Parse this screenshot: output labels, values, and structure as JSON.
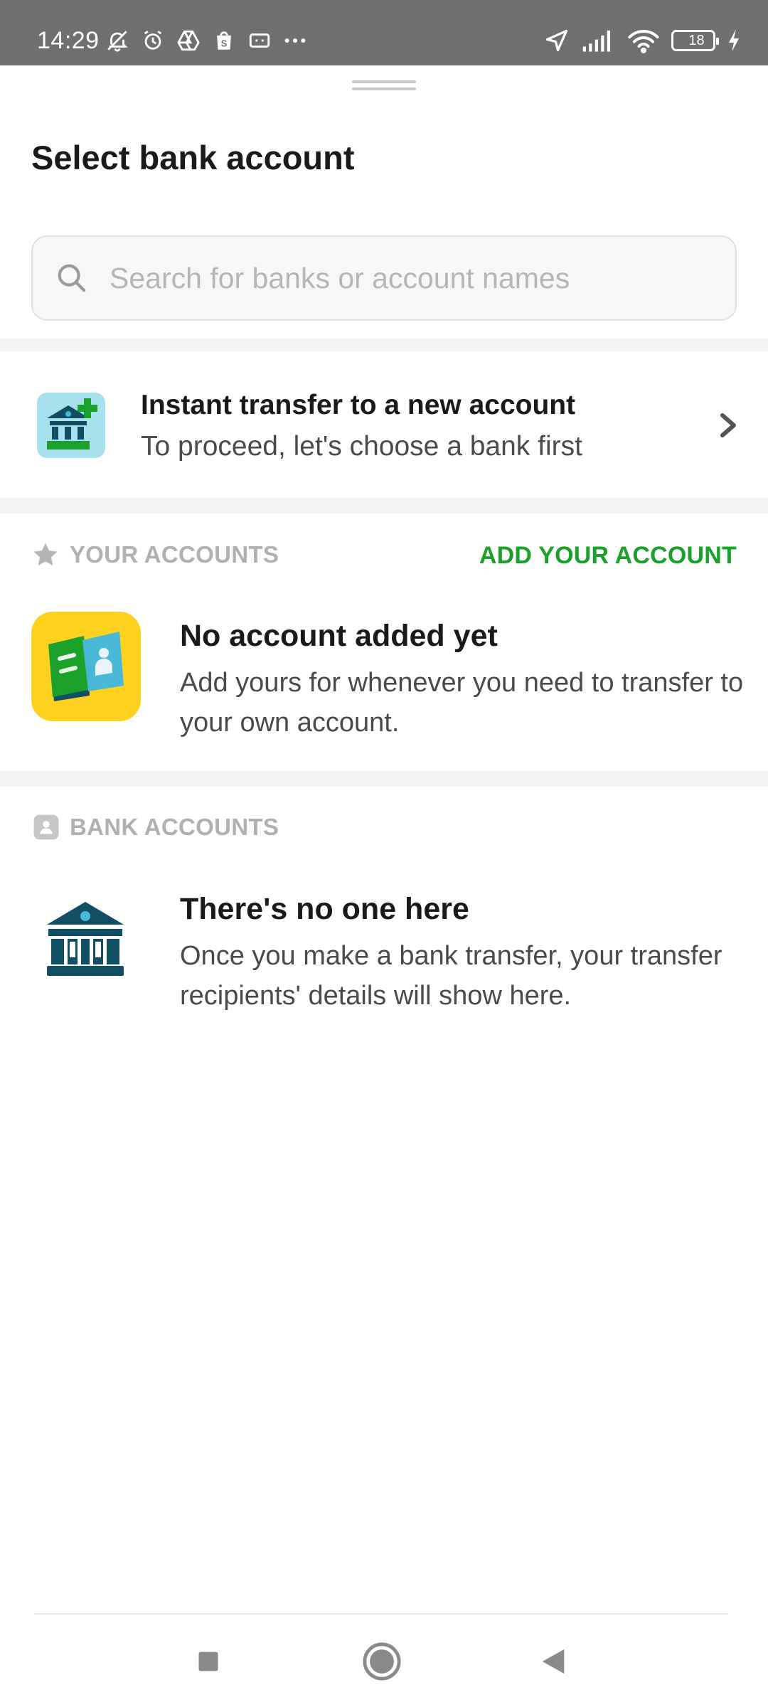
{
  "status_bar": {
    "time": "14:29",
    "battery_level": "18",
    "left_icons": [
      "mute-bell-icon",
      "alarm-icon",
      "drive-icon",
      "shop-icon",
      "card-icon",
      "more-dots-icon"
    ],
    "right_icons": [
      "location-arrow-icon",
      "signal-icon",
      "wifi-icon",
      "battery-icon",
      "charging-icon"
    ]
  },
  "sheet": {
    "title": "Select bank account"
  },
  "search": {
    "placeholder": "Search for banks or account names",
    "value": ""
  },
  "instant_transfer": {
    "title": "Instant transfer to a new account",
    "subtitle": "To proceed, let's choose a bank first"
  },
  "your_accounts": {
    "header": "YOUR ACCOUNTS",
    "action": "ADD YOUR ACCOUNT",
    "empty_title": "No account added yet",
    "empty_desc": "Add yours for whenever you need to transfer to your own account."
  },
  "bank_accounts": {
    "header": "BANK ACCOUNTS",
    "empty_title": "There's no one here",
    "empty_desc": "Once you make a bank transfer, your transfer recipients' details will show here."
  },
  "colors": {
    "accent_green": "#1ba12a",
    "status_bar": "#6f6f6f",
    "icon_teal": "#0f4e63",
    "icon_yellow": "#ffd21f"
  },
  "nav_bar": [
    "recents-square-icon",
    "home-circle-icon",
    "back-triangle-icon"
  ]
}
